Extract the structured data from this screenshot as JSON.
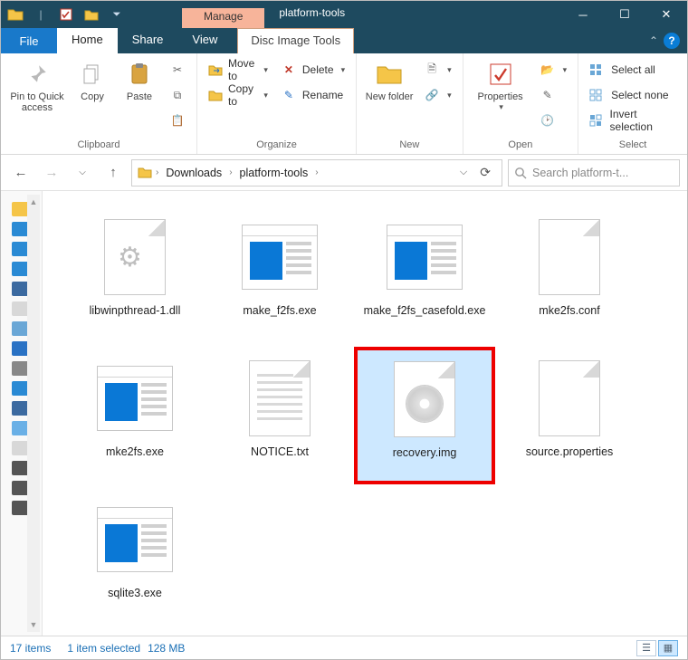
{
  "titlebar": {
    "manage_label": "Manage",
    "window_title": "platform-tools"
  },
  "tabs": {
    "file": "File",
    "home": "Home",
    "share": "Share",
    "view": "View",
    "tool_tab": "Disc Image Tools"
  },
  "ribbon": {
    "clipboard": {
      "pin": "Pin to Quick access",
      "copy": "Copy",
      "paste": "Paste",
      "group": "Clipboard"
    },
    "organize": {
      "move": "Move to",
      "copy": "Copy to",
      "delete": "Delete",
      "rename": "Rename",
      "group": "Organize"
    },
    "new": {
      "newfolder": "New folder",
      "group": "New"
    },
    "open": {
      "properties": "Properties",
      "group": "Open"
    },
    "select": {
      "all": "Select all",
      "none": "Select none",
      "invert": "Invert selection",
      "group": "Select"
    }
  },
  "nav": {
    "crumb1": "Downloads",
    "crumb2": "platform-tools",
    "search_placeholder": "Search platform-t..."
  },
  "files": [
    {
      "name": "libwinpthread-1.dll",
      "type": "dll"
    },
    {
      "name": "make_f2fs.exe",
      "type": "exe"
    },
    {
      "name": "make_f2fs_casefold.exe",
      "type": "exe"
    },
    {
      "name": "mke2fs.conf",
      "type": "blank"
    },
    {
      "name": "mke2fs.exe",
      "type": "exe"
    },
    {
      "name": "NOTICE.txt",
      "type": "txt"
    },
    {
      "name": "recovery.img",
      "type": "img",
      "selected": true,
      "highlight": true
    },
    {
      "name": "source.properties",
      "type": "blank"
    },
    {
      "name": "sqlite3.exe",
      "type": "exe"
    }
  ],
  "status": {
    "count": "17 items",
    "selection": "1 item selected",
    "size": "128 MB"
  }
}
